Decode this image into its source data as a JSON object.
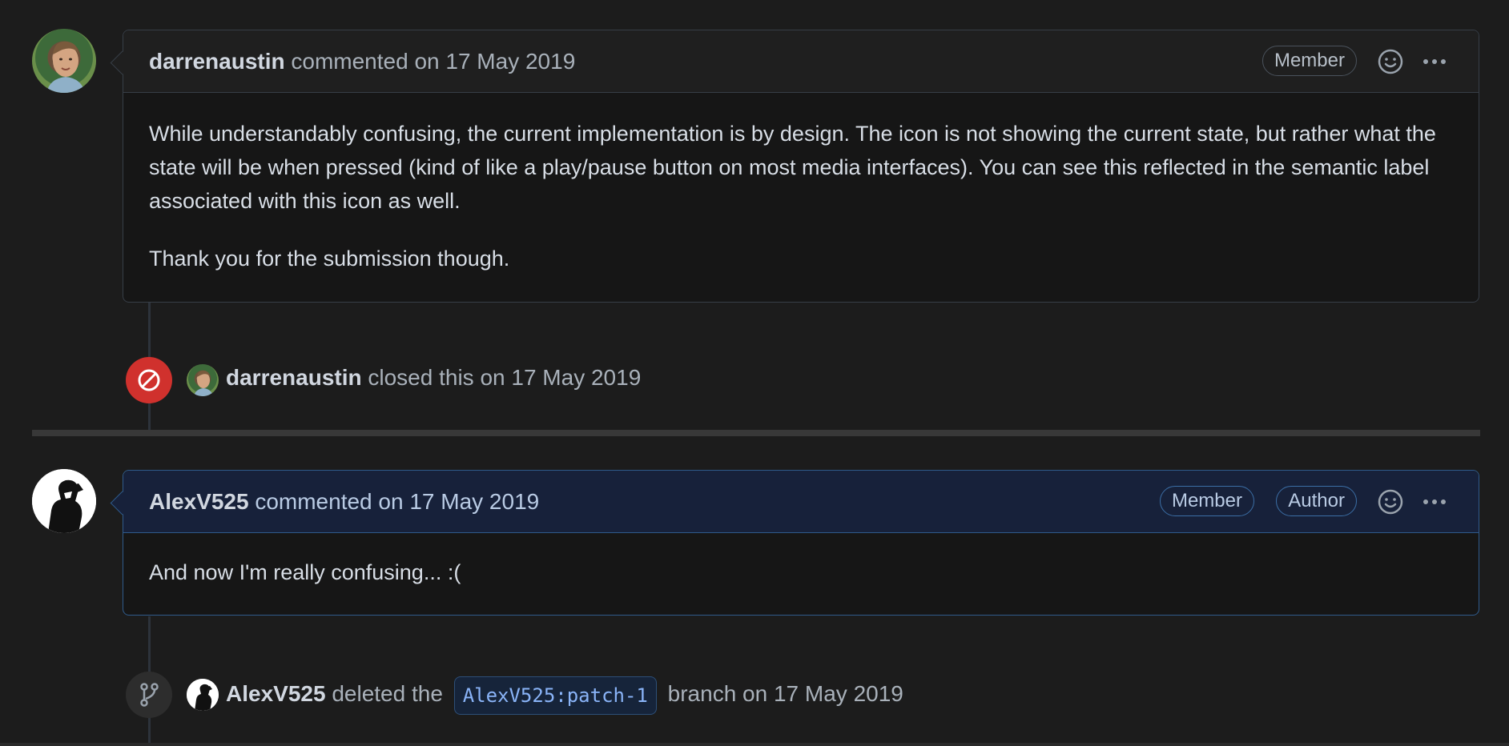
{
  "comments": [
    {
      "username": "darrenaustin",
      "action": "commented on 17 May 2019",
      "badges": [
        "Member"
      ],
      "paragraphs": [
        "While understandably confusing, the current implementation is by design. The icon is not showing the current state, but rather what the state will be when pressed (kind of like a play/pause button on most media interfaces). You can see this reflected in the semantic label associated with this icon as well.",
        "Thank you for the submission though."
      ],
      "icons": [
        "smiley-icon",
        "more-horizontal-icon"
      ]
    },
    {
      "username": "AlexV525",
      "action": "commented on 17 May 2019",
      "badges": [
        "Member",
        "Author"
      ],
      "paragraphs": [
        "And now I'm really confusing... :("
      ],
      "icons": [
        "smiley-icon",
        "more-horizontal-icon"
      ]
    }
  ],
  "events": [
    {
      "icon": "circle-slash-icon",
      "icon_color": "#d0312d",
      "username": "darrenaustin",
      "text": "closed this on 17 May 2019"
    },
    {
      "icon": "git-branch-icon",
      "username": "AlexV525",
      "text_before": "deleted the",
      "branch": "AlexV525:patch-1",
      "text_after": "branch on 17 May 2019"
    }
  ],
  "colors": {
    "background": "#1c1c1c",
    "author_accent": "#2f5a8a",
    "closed_red": "#d0312d",
    "branch_link": "#8ab4f8"
  }
}
